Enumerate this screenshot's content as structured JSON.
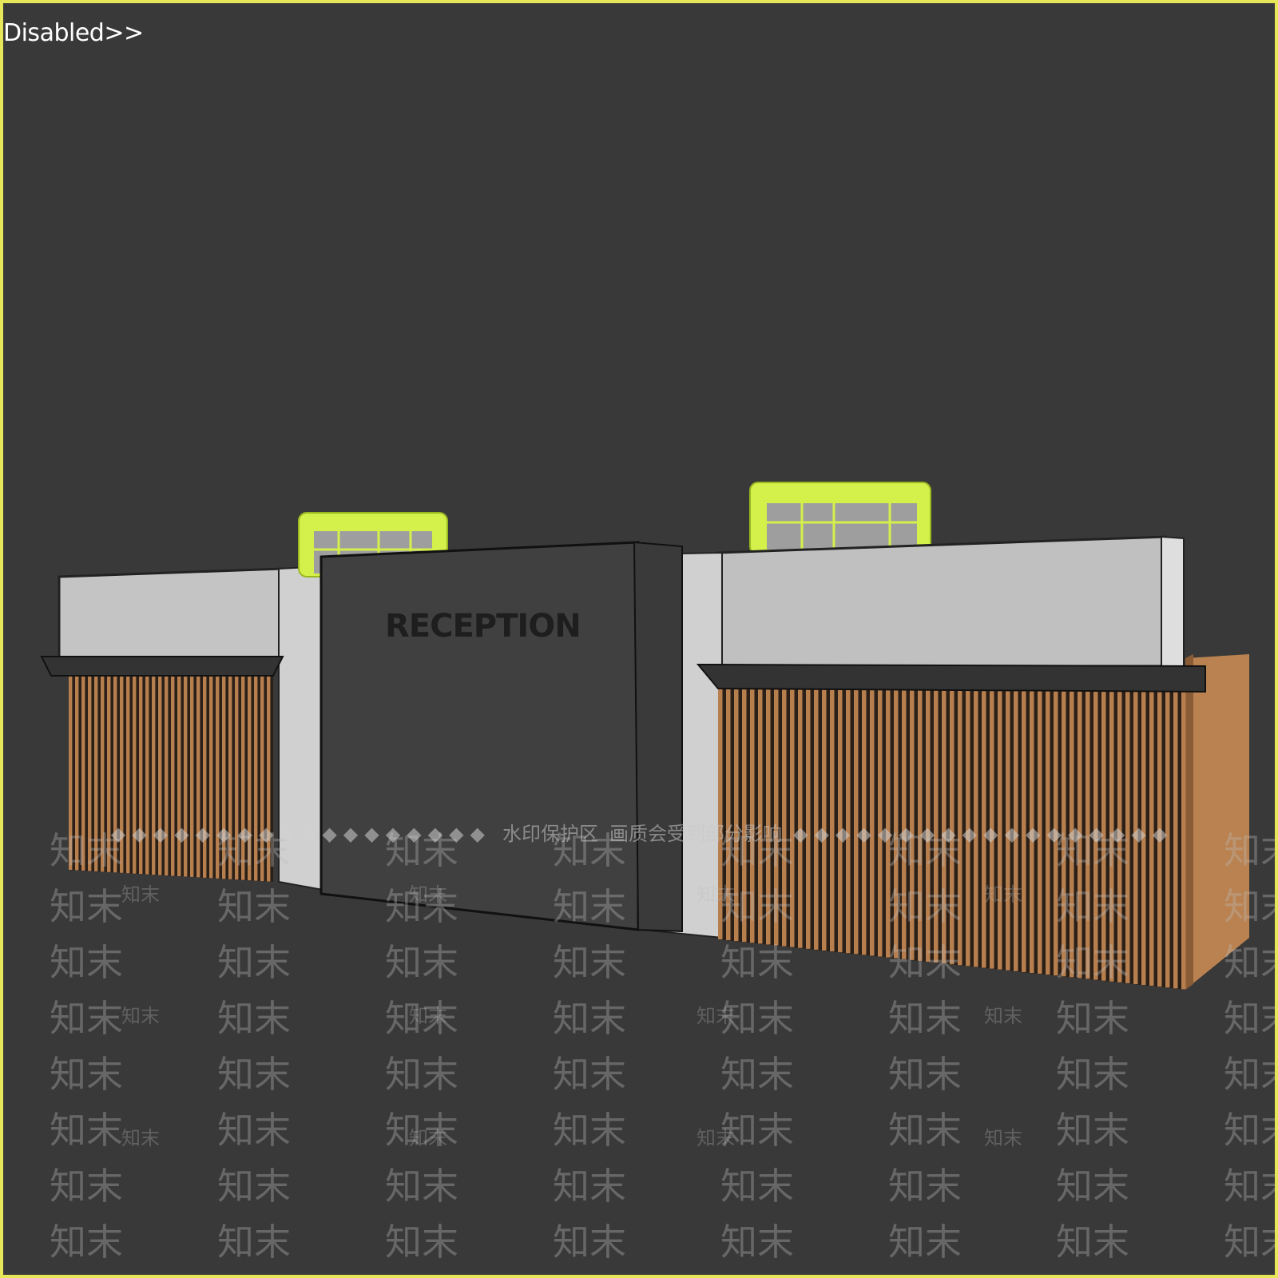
{
  "viewport": {
    "label": "Disabled>>",
    "border_color": "#e6e65a",
    "background_color": "#393939"
  },
  "scene": {
    "sign_text": "RECEPTION",
    "colors": {
      "panel_light": "#bdbdbd",
      "panel_dark": "#404040",
      "wood": "#b77e4e",
      "monitor_green": "#d4f04a"
    }
  },
  "watermark": {
    "banner_text_1": "水印保护区",
    "banner_text_2": "画质会受到部分影响",
    "tile_text": "知末"
  }
}
